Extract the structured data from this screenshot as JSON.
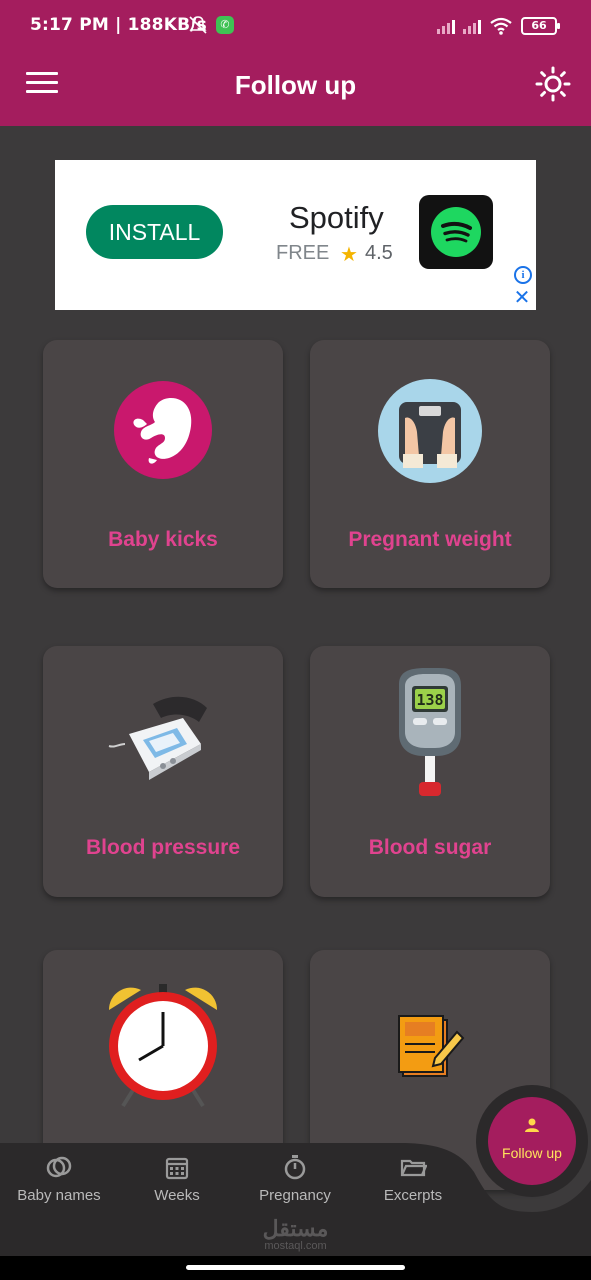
{
  "status_bar": {
    "time_speed": "5:17 PM | 188KB/s",
    "battery": "66",
    "icons": [
      "bell-off-icon",
      "whatsapp-icon",
      "signal-icon",
      "signal-icon",
      "wifi-icon",
      "battery-icon"
    ]
  },
  "app_bar": {
    "title": "Follow up",
    "menu_icon": "hamburger-menu-icon",
    "theme_icon": "sun-icon"
  },
  "ad": {
    "install_label": "INSTALL",
    "app_name": "Spotify",
    "price": "FREE",
    "rating": "4.5",
    "star_icon": "star-icon",
    "info_icon": "info-icon",
    "close_icon": "close-icon",
    "brand_color": "#01875f"
  },
  "cards": [
    {
      "label": "Baby kicks",
      "icon": "fetus-icon"
    },
    {
      "label": "Pregnant weight",
      "icon": "scale-icon"
    },
    {
      "label": "Blood pressure",
      "icon": "blood-pressure-monitor-icon"
    },
    {
      "label": "Blood sugar",
      "icon": "glucometer-icon",
      "display": "138"
    },
    {
      "label": "",
      "icon": "alarm-clock-icon"
    },
    {
      "label": "",
      "icon": "notepad-icon"
    }
  ],
  "bottom_nav": {
    "items": [
      {
        "label": "Baby names",
        "icon": "rings-icon"
      },
      {
        "label": "Weeks",
        "icon": "calendar-icon"
      },
      {
        "label": "Pregnancy",
        "icon": "stopwatch-icon"
      },
      {
        "label": "Excerpts",
        "icon": "folder-icon"
      }
    ],
    "fab": {
      "label": "Follow up",
      "icon": "person-icon"
    }
  },
  "watermark": {
    "arabic": "مستقل",
    "latin": "mostaql.com"
  },
  "colors": {
    "primary": "#a41d5e",
    "accent_text": "#e0438f",
    "background": "#3c3a3b",
    "card": "#4a4546"
  }
}
